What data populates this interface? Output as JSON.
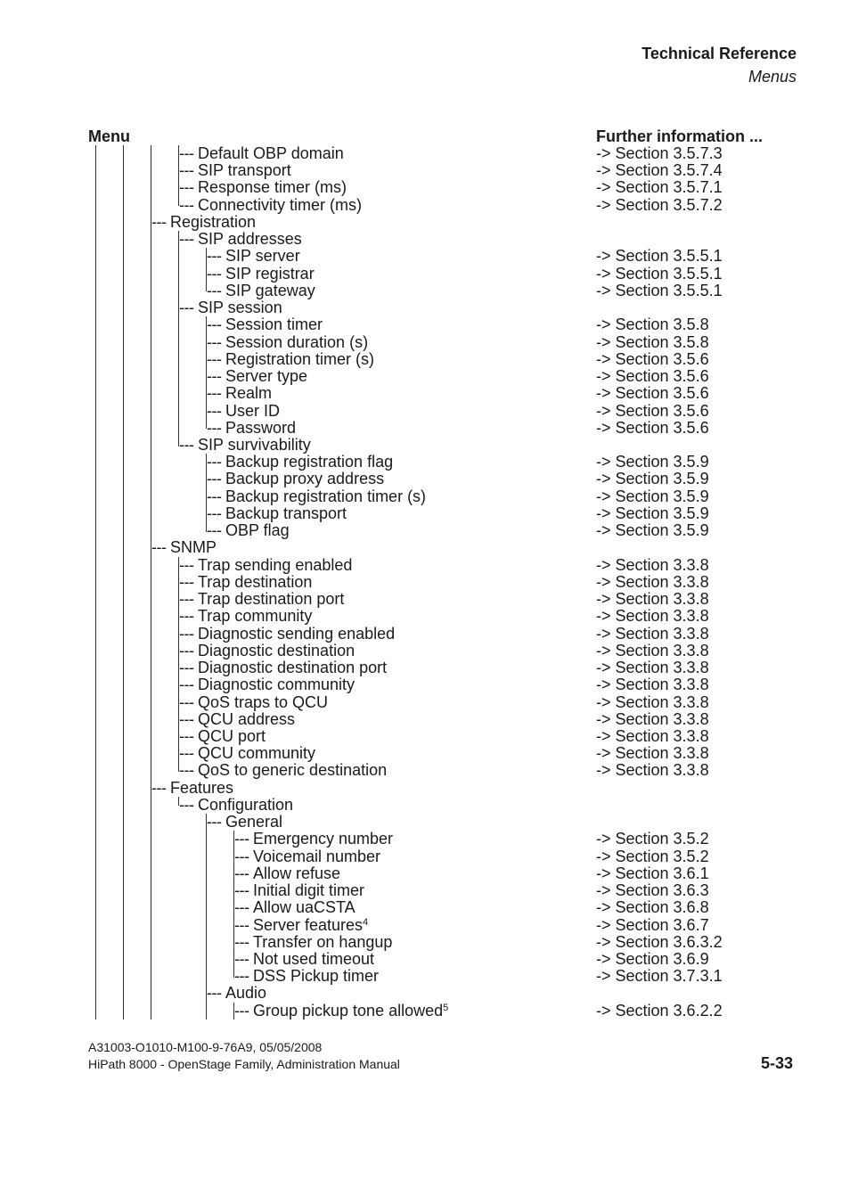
{
  "header": {
    "title": "Technical Reference",
    "subtitle": "Menus"
  },
  "columns": {
    "menu": "Menu",
    "info": "Further information ..."
  },
  "rows": [
    {
      "d": 3,
      "t": "Default OBP domain",
      "r": "-> Section 3.5.7.3"
    },
    {
      "d": 3,
      "t": "SIP transport",
      "r": "-> Section 3.5.7.4"
    },
    {
      "d": 3,
      "t": "Response timer (ms)",
      "r": "-> Section 3.5.7.1"
    },
    {
      "d": 3,
      "t": "Connectivity timer (ms)",
      "r": "-> Section 3.5.7.2",
      "last": true
    },
    {
      "d": 2,
      "t": "Registration",
      "r": ""
    },
    {
      "d": 3,
      "t": "SIP addresses",
      "r": ""
    },
    {
      "d": 4,
      "t": "SIP server",
      "r": "-> Section 3.5.5.1"
    },
    {
      "d": 4,
      "t": "SIP registrar",
      "r": "-> Section 3.5.5.1"
    },
    {
      "d": 4,
      "t": "SIP gateway",
      "r": "-> Section 3.5.5.1",
      "last": true
    },
    {
      "d": 3,
      "t": "SIP session",
      "r": ""
    },
    {
      "d": 4,
      "t": "Session timer",
      "r": "-> Section 3.5.8"
    },
    {
      "d": 4,
      "t": "Session duration (s)",
      "r": "-> Section 3.5.8"
    },
    {
      "d": 4,
      "t": "Registration timer (s)",
      "r": "-> Section 3.5.6"
    },
    {
      "d": 4,
      "t": "Server type",
      "r": "-> Section 3.5.6"
    },
    {
      "d": 4,
      "t": "Realm",
      "r": "-> Section 3.5.6"
    },
    {
      "d": 4,
      "t": "User ID",
      "r": "-> Section 3.5.6"
    },
    {
      "d": 4,
      "t": "Password",
      "r": "-> Section 3.5.6",
      "last": true
    },
    {
      "d": 3,
      "t": "SIP survivability",
      "r": "",
      "last": true
    },
    {
      "d": 4,
      "t": "Backup registration flag",
      "r": "-> Section 3.5.9"
    },
    {
      "d": 4,
      "t": "Backup proxy address",
      "r": "-> Section 3.5.9"
    },
    {
      "d": 4,
      "t": "Backup registration timer (s)",
      "r": "-> Section 3.5.9"
    },
    {
      "d": 4,
      "t": "Backup transport",
      "r": "-> Section 3.5.9"
    },
    {
      "d": 4,
      "t": "OBP flag",
      "r": "-> Section 3.5.9",
      "last": true
    },
    {
      "d": 2,
      "t": "SNMP",
      "r": ""
    },
    {
      "d": 3,
      "t": "Trap sending enabled",
      "r": "-> Section 3.3.8"
    },
    {
      "d": 3,
      "t": "Trap destination",
      "r": "-> Section 3.3.8"
    },
    {
      "d": 3,
      "t": "Trap destination port",
      "r": "-> Section 3.3.8"
    },
    {
      "d": 3,
      "t": "Trap community",
      "r": "-> Section 3.3.8"
    },
    {
      "d": 3,
      "t": "Diagnostic sending enabled",
      "r": "-> Section 3.3.8"
    },
    {
      "d": 3,
      "t": "Diagnostic destination",
      "r": "-> Section 3.3.8"
    },
    {
      "d": 3,
      "t": "Diagnostic destination port",
      "r": "-> Section 3.3.8"
    },
    {
      "d": 3,
      "t": "Diagnostic community",
      "r": "-> Section 3.3.8"
    },
    {
      "d": 3,
      "t": "QoS traps to QCU",
      "r": "-> Section 3.3.8"
    },
    {
      "d": 3,
      "t": "QCU address",
      "r": "-> Section 3.3.8"
    },
    {
      "d": 3,
      "t": "QCU port",
      "r": "-> Section 3.3.8"
    },
    {
      "d": 3,
      "t": "QCU community",
      "r": "-> Section 3.3.8"
    },
    {
      "d": 3,
      "t": "QoS to generic destination",
      "r": "-> Section 3.3.8",
      "last": true
    },
    {
      "d": 2,
      "t": "Features",
      "r": ""
    },
    {
      "d": 3,
      "t": "Configuration",
      "r": "",
      "last": true
    },
    {
      "d": 4,
      "t": "General",
      "r": ""
    },
    {
      "d": 5,
      "t": "Emergency number",
      "r": "-> Section 3.5.2"
    },
    {
      "d": 5,
      "t": "Voicemail number",
      "r": "-> Section 3.5.2"
    },
    {
      "d": 5,
      "t": "Allow refuse",
      "r": "-> Section 3.6.1"
    },
    {
      "d": 5,
      "t": "Initial digit timer",
      "r": "-> Section 3.6.3"
    },
    {
      "d": 5,
      "t": "Allow uaCSTA",
      "r": "-> Section 3.6.8"
    },
    {
      "d": 5,
      "t": "Server features",
      "sup": "4",
      "r": "-> Section 3.6.7"
    },
    {
      "d": 5,
      "t": "Transfer on hangup",
      "r": "-> Section 3.6.3.2"
    },
    {
      "d": 5,
      "t": "Not used timeout",
      "r": "-> Section 3.6.9"
    },
    {
      "d": 5,
      "t": "DSS Pickup timer",
      "r": "-> Section 3.7.3.1",
      "last": true
    },
    {
      "d": 4,
      "t": "Audio",
      "r": ""
    },
    {
      "d": 5,
      "t": "Group pickup tone allowed",
      "sup": "5",
      "r": "-> Section 3.6.2.2"
    }
  ],
  "footer": {
    "doc_id": "A31003-O1010-M100-9-76A9, 05/05/2008",
    "doc_title": "HiPath 8000 - OpenStage Family, Administration Manual",
    "page": "5-33"
  }
}
